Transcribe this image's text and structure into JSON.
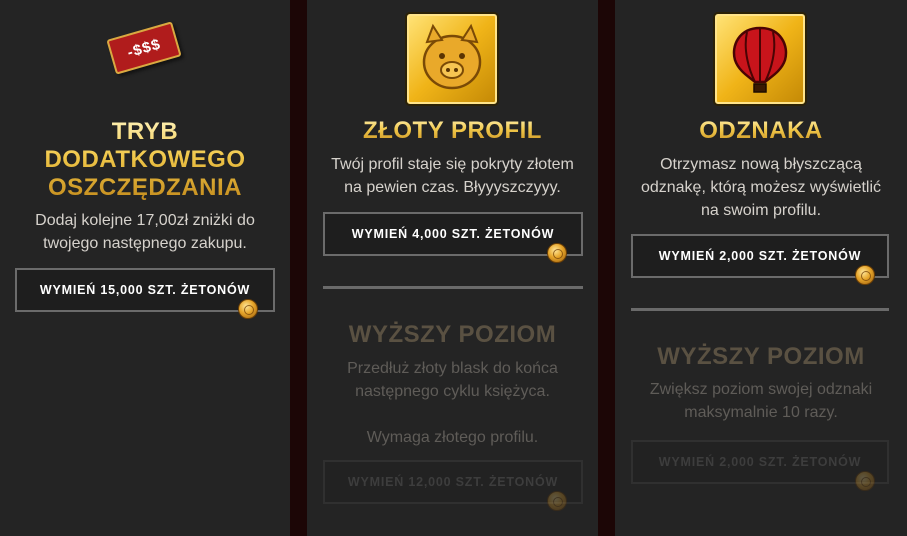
{
  "cards": [
    {
      "icon": "price-tag-icon",
      "icon_text": "-$$$",
      "title": "TRYB\nDODATKOWEGO\nOSZCZĘDZANIA",
      "description": "Dodaj kolejne 17,00zł zniżki do\ntwojego następnego zakupu.",
      "button": "WYMIEŃ 15,000 SZT. ŻETONÓW"
    },
    {
      "icon": "golden-pig-icon",
      "title": "ZŁOTY PROFIL",
      "description": "Twój profil staje się pokryty złotem\nna pewien czas. Błyyyszczyyy.",
      "button": "WYMIEŃ 4,000 SZT. ŻETONÓW",
      "upgrade": {
        "title": "WYŻSZY POZIOM",
        "description": "Przedłuż złoty blask do końca\nnastępnego cyklu księżyca.\n\nWymaga złotego profilu.",
        "button": "WYMIEŃ 12,000 SZT. ŻETONÓW"
      }
    },
    {
      "icon": "hot-air-balloon-badge-icon",
      "title": "ODZNAKA",
      "description": "Otrzymasz nową błyszczącą\nodznakę, którą możesz wyświetlić\nna swoim profilu.",
      "button": "WYMIEŃ 2,000 SZT. ŻETONÓW",
      "upgrade": {
        "title": "WYŻSZY POZIOM",
        "description": "Zwiększ poziom swojej odznaki\nmaksymalnie 10 razy.",
        "button": "WYMIEŃ 2,000 SZT. ŻETONÓW"
      }
    }
  ],
  "colors": {
    "background": "#242424",
    "gap": "#1c0606",
    "gold": "#f1c84a",
    "dim_title": "#5a5142"
  }
}
